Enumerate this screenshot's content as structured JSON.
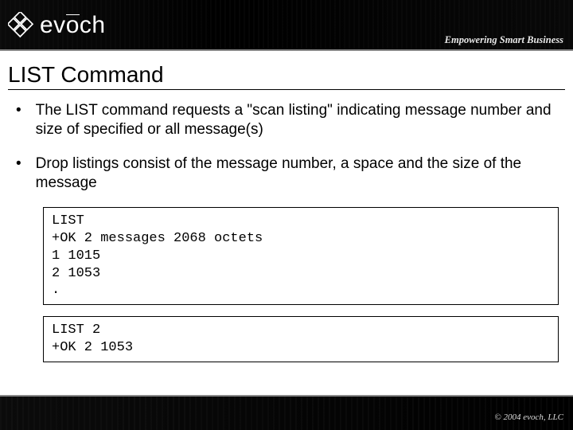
{
  "header": {
    "brand": "evōch",
    "tagline": "Empowering Smart Business"
  },
  "slide": {
    "title": "LIST Command",
    "bullets": [
      "The LIST command requests a \"scan listing\" indicating message number and size of specified or all message(s)",
      "Drop listings consist of the message number, a space and the size of the message"
    ],
    "code_blocks": [
      "LIST\n+OK 2 messages 2068 octets\n1 1015\n2 1053\n.",
      "LIST 2\n+OK 2 1053"
    ]
  },
  "footer": {
    "copyright": "© 2004 evoch, LLC"
  }
}
